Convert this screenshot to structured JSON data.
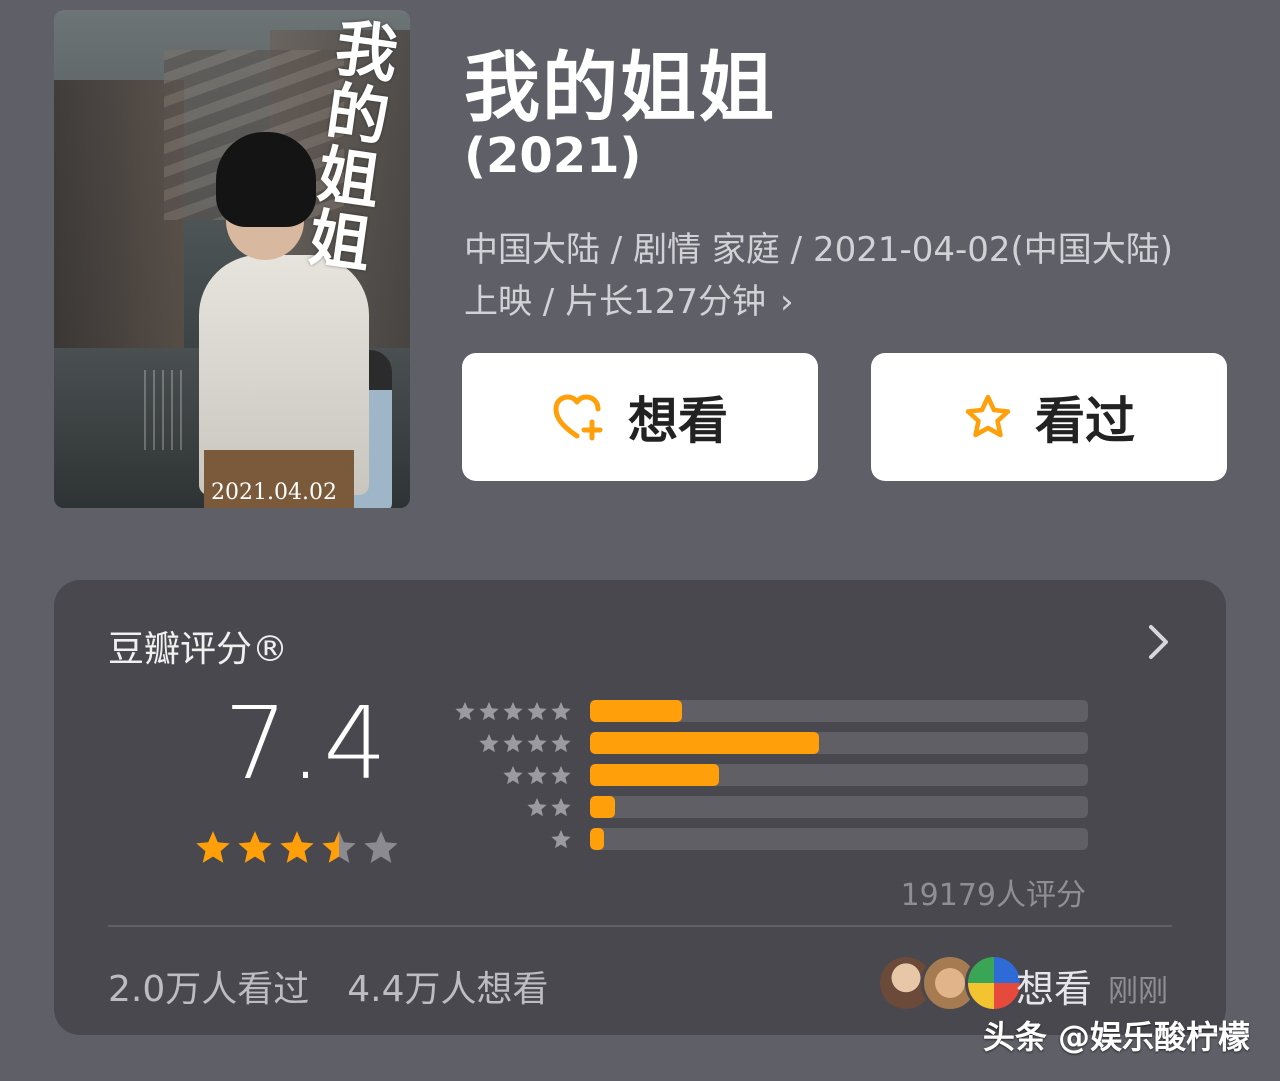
{
  "movie": {
    "poster_title": "我的姐姐",
    "poster_date": "2021.04.02",
    "title": "我的姐姐",
    "year": "(2021)",
    "meta_line": "中国大陆 / 剧情 家庭 / 2021-04-02(中国大陆)上映 / 片长127分钟",
    "meta_chevron": "›"
  },
  "actions": {
    "want_label": "想看",
    "seen_label": "看过"
  },
  "rating": {
    "section_title": "豆瓣评分®",
    "score": "7.4",
    "stars_out_of_5": 3.5,
    "distribution": [
      {
        "stars": 5,
        "fraction": 0.185
      },
      {
        "stars": 4,
        "fraction": 0.46
      },
      {
        "stars": 3,
        "fraction": 0.26
      },
      {
        "stars": 2,
        "fraction": 0.05
      },
      {
        "stars": 1,
        "fraction": 0.027
      }
    ],
    "count_label": "19179人评分"
  },
  "footer": {
    "seen_count": "2.0万人看过",
    "want_count": "4.4万人想看",
    "activity_label": "想看",
    "activity_time": "刚刚"
  },
  "watermark": "头条 @娱乐酸柠檬",
  "colors": {
    "accent": "#ff9f0a",
    "background": "#5f5f67",
    "panel": "#48484e",
    "track": "#5f5f65"
  }
}
